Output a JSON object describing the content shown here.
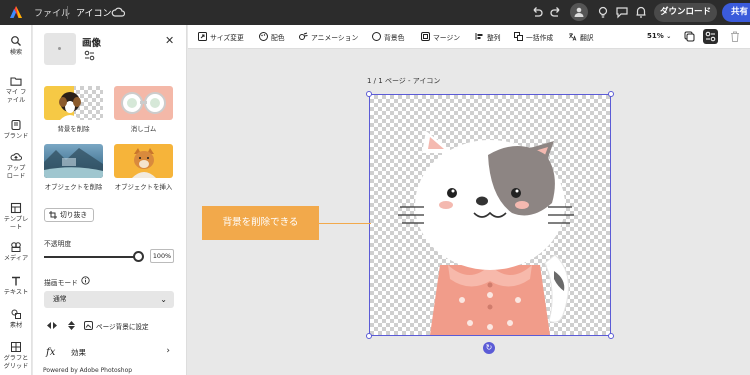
{
  "topbar": {
    "menu_file": "ファイル",
    "doc_name": "アイコン",
    "download": "ダウンロード",
    "share": "共有"
  },
  "rail": [
    {
      "label": "検索"
    },
    {
      "label": "マイ ファイル"
    },
    {
      "label": "ブランド"
    },
    {
      "label": "アップ ロード"
    },
    {
      "label": "テンプレート"
    },
    {
      "label": "メディア"
    },
    {
      "label": "テキスト"
    },
    {
      "label": "素材"
    },
    {
      "label": "グラフと グリッド"
    }
  ],
  "panel": {
    "title": "画像",
    "options": [
      {
        "label": "背景を削除"
      },
      {
        "label": "消しゴム"
      },
      {
        "label": "オブジェクトを削除"
      },
      {
        "label": "オブジェクトを挿入"
      }
    ],
    "crop": "切り抜き",
    "opacity_label": "不透明度",
    "opacity_value": "100%",
    "opacity": 1.0,
    "blend_label": "描画モード",
    "blend_value": "通常",
    "set_bg": "ページ背景に設定",
    "effects": "効果",
    "powered": "Powered by Adobe Photoshop"
  },
  "toolbar": {
    "resize": "サイズ変更",
    "color": "配色",
    "animation": "アニメーション",
    "bg_color": "背景色",
    "margin": "マージン",
    "align": "整列",
    "bulk": "一括作成",
    "translate": "翻訳",
    "zoom": "51%"
  },
  "canvas": {
    "page_label": "1 / 1 ページ - アイコン",
    "callout": "背景を削除できる"
  },
  "colors": {
    "accent": "#5b5bd6",
    "callout": "#f2a94b",
    "share": "#3b5bdb"
  }
}
